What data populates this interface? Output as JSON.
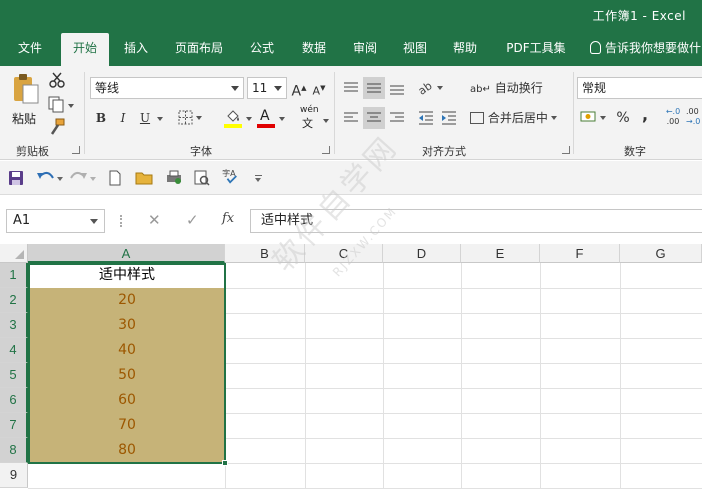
{
  "window": {
    "title": "工作簿1  -  Excel"
  },
  "tabs": [
    {
      "label": "文件",
      "active": false
    },
    {
      "label": "开始",
      "active": true
    },
    {
      "label": "插入",
      "active": false
    },
    {
      "label": "页面布局",
      "active": false
    },
    {
      "label": "公式",
      "active": false
    },
    {
      "label": "数据",
      "active": false
    },
    {
      "label": "审阅",
      "active": false
    },
    {
      "label": "视图",
      "active": false
    },
    {
      "label": "帮助",
      "active": false
    },
    {
      "label": "PDF工具集",
      "active": false
    }
  ],
  "tell_me": "告诉我你想要做什",
  "ribbon": {
    "clipboard": {
      "paste_label": "粘贴",
      "group_label": "剪贴板"
    },
    "font": {
      "font_name": "等线",
      "font_size": "11",
      "grow_label": "A",
      "shrink_label": "A",
      "bold_label": "B",
      "italic_label": "I",
      "underline_label": "U",
      "fill_label": "A",
      "color_label": "A",
      "phonetic_label": "wén",
      "group_label": "字体",
      "fill_color": "#ffff00",
      "font_color": "#e00000"
    },
    "alignment": {
      "wrap_label": "自动换行",
      "merge_label": "合并后居中",
      "group_label": "对齐方式"
    },
    "number": {
      "format": "常规",
      "percent_label": "%",
      "comma_label": ",",
      "inc_decimal_label": ".00",
      "dec_decimal_label": ".00",
      "group_label": "数字"
    }
  },
  "formula_bar": {
    "name_box": "A1",
    "cancel_label": "✕",
    "enter_label": "✓",
    "fx_label": "fx",
    "formula": "适中样式"
  },
  "sheet": {
    "columns": [
      "A",
      "B",
      "C",
      "D",
      "E",
      "F",
      "G"
    ],
    "rows": [
      "1",
      "2",
      "3",
      "4",
      "5",
      "6",
      "7",
      "8",
      "9"
    ],
    "cells": {
      "A1": "适中样式",
      "A2": "20",
      "A3": "30",
      "A4": "40",
      "A5": "50",
      "A6": "60",
      "A7": "70",
      "A8": "80"
    },
    "neutral_fill": "#c6b378",
    "neutral_text": "#9c5700"
  },
  "watermark": {
    "main": "软件自学网",
    "sub": "RJZXW.COM"
  }
}
